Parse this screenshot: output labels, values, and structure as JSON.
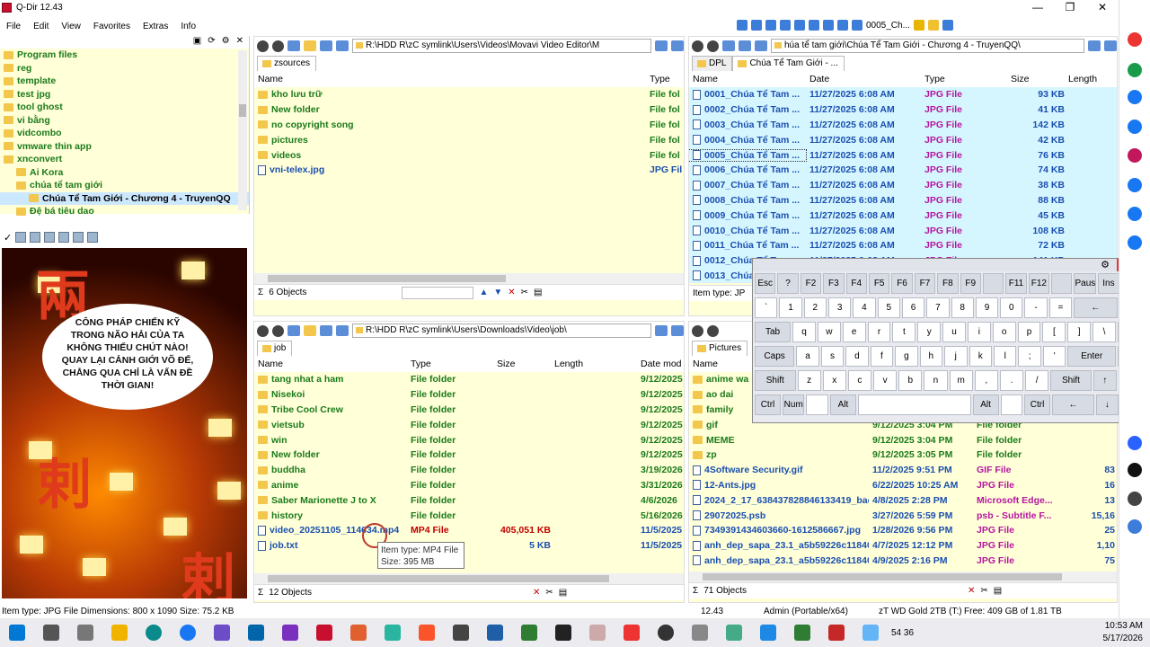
{
  "app": {
    "title": "Q-Dir 12.43",
    "menu": [
      "File",
      "Edit",
      "View",
      "Favorites",
      "Extras",
      "Info"
    ],
    "toolbar_label": "0005_Ch..."
  },
  "tree": {
    "items": [
      "Program files",
      "reg",
      "template",
      "test jpg",
      "tool ghost",
      "vi bằng",
      "vidcombo",
      "vmware thin app",
      "xnconvert",
      "Ai Kora",
      "chúa tể tam giới",
      "Chúa Tể Tam Giới - Chương 4 - TruyenQQ",
      "Đệ bá tiêu dao"
    ]
  },
  "preview": {
    "bubble_text": "CÔNG PHÁP CHIẾN KỸ TRONG NÃO HẢI CỦA TA KHÔNG THIẾU CHÚT NÀO! QUAY LẠI CẢNH GIỚI VÕ ĐẾ, CHẲNG QUA CHỈ LÀ VẤN ĐỀ THỜI GIAN!",
    "chars": [
      "兩",
      "剌",
      "剌"
    ]
  },
  "pane1": {
    "path": "R:\\HDD R\\zC symlink\\Users\\Videos\\Movavi Video Editor\\M",
    "tab": "zsources",
    "headers": [
      "Name",
      "Type"
    ],
    "rows": [
      {
        "name": "kho lưu trữ",
        "type": "File fol"
      },
      {
        "name": "New folder",
        "type": "File fol"
      },
      {
        "name": "no copyright song",
        "type": "File fol"
      },
      {
        "name": "pictures",
        "type": "File fol"
      },
      {
        "name": "videos",
        "type": "File fol"
      },
      {
        "name": "vni-telex.jpg",
        "type": "JPG File"
      }
    ],
    "status": "6 Objects"
  },
  "pane2": {
    "path": "húa tể tam giới\\Chúa Tể Tam Giới - Chương 4 - TruyenQQ\\",
    "tabs": [
      "DPL",
      "Chúa Tể Tam Giới - ..."
    ],
    "headers": [
      "Name",
      "Date",
      "Type",
      "Size",
      "Length"
    ],
    "rows": [
      {
        "name": "0001_Chúa Tể Tam ...",
        "date": "11/27/2025 6:08 AM",
        "type": "JPG File",
        "size": "93 KB"
      },
      {
        "name": "0002_Chúa Tể Tam ...",
        "date": "11/27/2025 6:08 AM",
        "type": "JPG File",
        "size": "41 KB"
      },
      {
        "name": "0003_Chúa Tể Tam ...",
        "date": "11/27/2025 6:08 AM",
        "type": "JPG File",
        "size": "142 KB"
      },
      {
        "name": "0004_Chúa Tể Tam ...",
        "date": "11/27/2025 6:08 AM",
        "type": "JPG File",
        "size": "42 KB"
      },
      {
        "name": "0005_Chúa Tể Tam ...",
        "date": "11/27/2025 6:08 AM",
        "type": "JPG File",
        "size": "76 KB"
      },
      {
        "name": "0006_Chúa Tể Tam ...",
        "date": "11/27/2025 6:08 AM",
        "type": "JPG File",
        "size": "74 KB"
      },
      {
        "name": "0007_Chúa Tể Tam ...",
        "date": "11/27/2025 6:08 AM",
        "type": "JPG File",
        "size": "38 KB"
      },
      {
        "name": "0008_Chúa Tể Tam ...",
        "date": "11/27/2025 6:08 AM",
        "type": "JPG File",
        "size": "88 KB"
      },
      {
        "name": "0009_Chúa Tể Tam ...",
        "date": "11/27/2025 6:08 AM",
        "type": "JPG File",
        "size": "45 KB"
      },
      {
        "name": "0010_Chúa Tể Tam ...",
        "date": "11/27/2025 6:08 AM",
        "type": "JPG File",
        "size": "108 KB"
      },
      {
        "name": "0011_Chúa Tể Tam ...",
        "date": "11/27/2025 6:08 AM",
        "type": "JPG File",
        "size": "72 KB"
      },
      {
        "name": "0012_Chúa Tể Tam ...",
        "date": "11/27/2025 6:08 AM",
        "type": "JPG File",
        "size": "141 KB"
      },
      {
        "name": "0013_Chúa",
        "date": "",
        "type": "",
        "size": ""
      }
    ],
    "status": "Item type: JP"
  },
  "pane3": {
    "path": "R:\\HDD R\\zC symlink\\Users\\Downloads\\Video\\job\\",
    "tab": "job",
    "headers": [
      "Name",
      "Type",
      "Size",
      "Length",
      "Date mod"
    ],
    "rows": [
      {
        "name": "tang nhat a ham",
        "type": "File folder",
        "size": "",
        "date": "9/12/2025"
      },
      {
        "name": "Nisekoi",
        "type": "File folder",
        "size": "",
        "date": "9/12/2025"
      },
      {
        "name": "Tribe Cool Crew",
        "type": "File folder",
        "size": "",
        "date": "9/12/2025"
      },
      {
        "name": "vietsub",
        "type": "File folder",
        "size": "",
        "date": "9/12/2025"
      },
      {
        "name": "win",
        "type": "File folder",
        "size": "",
        "date": "9/12/2025"
      },
      {
        "name": "New folder",
        "type": "File folder",
        "size": "",
        "date": "9/12/2025"
      },
      {
        "name": "buddha",
        "type": "File folder",
        "size": "",
        "date": "3/19/2026"
      },
      {
        "name": "anime",
        "type": "File folder",
        "size": "",
        "date": "3/31/2026"
      },
      {
        "name": "Saber Marionette J to X",
        "type": "File folder",
        "size": "",
        "date": "4/6/2026"
      },
      {
        "name": "history",
        "type": "File folder",
        "size": "",
        "date": "5/16/2026"
      },
      {
        "name": "video_20251105_114634.mp4",
        "type": "MP4 File",
        "size": "405,051 KB",
        "date": "11/5/2025"
      },
      {
        "name": "job.txt",
        "type": "ent",
        "size": "5 KB",
        "date": "11/5/2025"
      }
    ],
    "status": "12 Objects",
    "tooltip_line1": "Item type: MP4 File",
    "tooltip_line2": "Size: 395 MB"
  },
  "pane4": {
    "tab": "Pictures",
    "headers": [
      "Name"
    ],
    "rows": [
      {
        "name": "anime wa",
        "date": "",
        "type": "",
        "size": ""
      },
      {
        "name": "ao dai",
        "date": "",
        "type": "",
        "size": ""
      },
      {
        "name": "family",
        "date": "",
        "type": "",
        "size": ""
      },
      {
        "name": "gif",
        "date": "9/12/2025 3:04 PM",
        "type": "File folder",
        "size": ""
      },
      {
        "name": "MEME",
        "date": "9/12/2025 3:04 PM",
        "type": "File folder",
        "size": ""
      },
      {
        "name": "zp",
        "date": "9/12/2025 3:05 PM",
        "type": "File folder",
        "size": ""
      },
      {
        "name": "4Software Security.gif",
        "date": "11/2/2025 9:51 PM",
        "type": "GIF File",
        "size": "83"
      },
      {
        "name": "12-Ants.jpg",
        "date": "6/22/2025 10:25 AM",
        "type": "JPG File",
        "size": "16"
      },
      {
        "name": "2024_2_17_638437828846133419_back...",
        "date": "4/8/2025 2:28 PM",
        "type": "Microsoft Edge...",
        "size": "13"
      },
      {
        "name": "29072025.psb",
        "date": "3/27/2026 5:59 PM",
        "type": "psb - Subtitle F...",
        "size": "15,16"
      },
      {
        "name": "7349391434603660-1612586667.jpg",
        "date": "1/28/2026 9:56 PM",
        "type": "JPG File",
        "size": "25"
      },
      {
        "name": "anh_dep_sapa_23.1_a5b59226c11840a...",
        "date": "4/7/2025 12:12 PM",
        "type": "JPG File",
        "size": "1,10"
      },
      {
        "name": "anh_dep_sapa_23.1_a5b59226c11840a...",
        "date": "4/9/2025 2:16 PM",
        "type": "JPG File",
        "size": "75"
      }
    ],
    "status": "71 Objects"
  },
  "keyboard": {
    "rows": [
      [
        "Esc",
        "?",
        "F2",
        "F3",
        "F4",
        "F5",
        "F6",
        "F7",
        "F8",
        "F9",
        "",
        "F11",
        "F12",
        "",
        "Paus",
        "Ins",
        "Del"
      ],
      [
        "`",
        "1",
        "2",
        "3",
        "4",
        "5",
        "6",
        "7",
        "8",
        "9",
        "0",
        "-",
        "=",
        "←",
        "Hom"
      ],
      [
        "Tab",
        "q",
        "w",
        "e",
        "r",
        "t",
        "y",
        "u",
        "i",
        "o",
        "p",
        "[",
        "]",
        "\\",
        "PgUp"
      ],
      [
        "Caps",
        "a",
        "s",
        "d",
        "f",
        "g",
        "h",
        "j",
        "k",
        "l",
        ";",
        "'",
        "Enter",
        "PgDn"
      ],
      [
        "Shift",
        "z",
        "x",
        "c",
        "v",
        "b",
        "n",
        "m",
        ",",
        ".",
        "/",
        "Shift",
        "↑",
        "End"
      ],
      [
        "Ctrl",
        "Num",
        "",
        "Alt",
        "",
        "Alt",
        "",
        "Ctrl",
        "←",
        "↓",
        "→"
      ]
    ]
  },
  "status_bar": {
    "left": "Item type: JPG File Dimensions: 800 x 1090 Size: 75.2 KB",
    "version": "12.43",
    "user": "Admin (Portable/x64)",
    "drive": "zT WD Gold 2TB (T:)",
    "free": "Free: 409 GB of 1.81 TB"
  },
  "taskbar": {
    "time": "10:53 AM",
    "date": "5/17/2026",
    "tray_nums": "54  36"
  }
}
